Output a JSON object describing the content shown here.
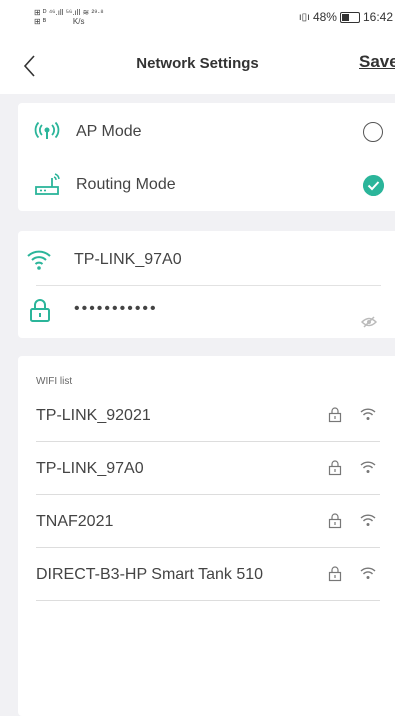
{
  "status_bar": {
    "left_text": "⊞ ᴰ ⁴⁶.ıll ⁵⁶.ıll ≋ ²⁹·⁸\n⊞ ᴮ            K/s",
    "battery": "48%",
    "time": "16:42"
  },
  "header": {
    "title": "Network Settings",
    "save_label": "Save"
  },
  "modes": [
    {
      "label": "AP Mode",
      "icon": "antenna-icon",
      "selected": false
    },
    {
      "label": "Routing Mode",
      "icon": "router-icon",
      "selected": true
    }
  ],
  "credentials": {
    "ssid": "TP-LINK_97A0",
    "password": "•••••••••••"
  },
  "wifi_list": {
    "label": "WIFI list",
    "networks": [
      {
        "name": "TP-LINK_92021"
      },
      {
        "name": "TP-LINK_97A0"
      },
      {
        "name": "TNAF2021"
      },
      {
        "name": "DIRECT-B3-HP Smart Tank 510"
      }
    ]
  },
  "colors": {
    "accent": "#2bb59a",
    "background": "#f1f1f4",
    "card": "#ffffff"
  }
}
